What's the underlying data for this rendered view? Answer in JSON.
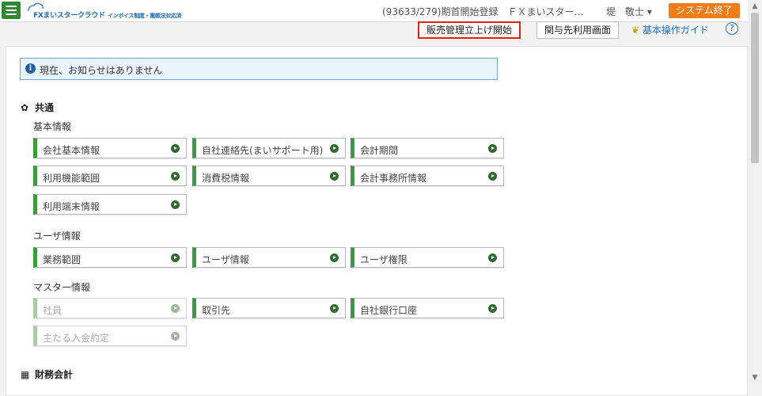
{
  "header": {
    "logo_text": "FXまいスタークラウド",
    "logo_sub": "インボイス制度・電帳法対応済",
    "session": "(93633/279)期首開始登録　ＦＸまいスター…",
    "user": "堤　敬士 ▾",
    "exit_label": "システム終了"
  },
  "toolbar": {
    "sales_start": "販売管理立上げ開始",
    "partner_screen": "関与先利用画面",
    "guide": "基本操作ガイド",
    "help": "?"
  },
  "notice": {
    "text": "現在、お知らせはありません",
    "icon": "i"
  },
  "sections": {
    "common": {
      "title": "共通"
    },
    "finance": {
      "title": "財務会計"
    }
  },
  "groups": {
    "basic": {
      "title": "基本情報",
      "items": [
        "会社基本情報",
        "自社連絡先(まいサポート用)",
        "会計期間",
        "利用機能範囲",
        "消費税情報",
        "会計事務所情報",
        "利用端末情報"
      ]
    },
    "user": {
      "title": "ユーザ情報",
      "items": [
        "業務範囲",
        "ユーザ情報",
        "ユーザ権限"
      ]
    },
    "master": {
      "title": "マスター情報",
      "items": [
        "社員",
        "取引先",
        "自社銀行口座",
        "主たる入金約定"
      ]
    }
  },
  "colors": {
    "accent_green": "#3c9a3c",
    "exit_orange": "#f07d1a",
    "highlight_red": "#e0201c",
    "link_blue": "#1e6fb5"
  }
}
